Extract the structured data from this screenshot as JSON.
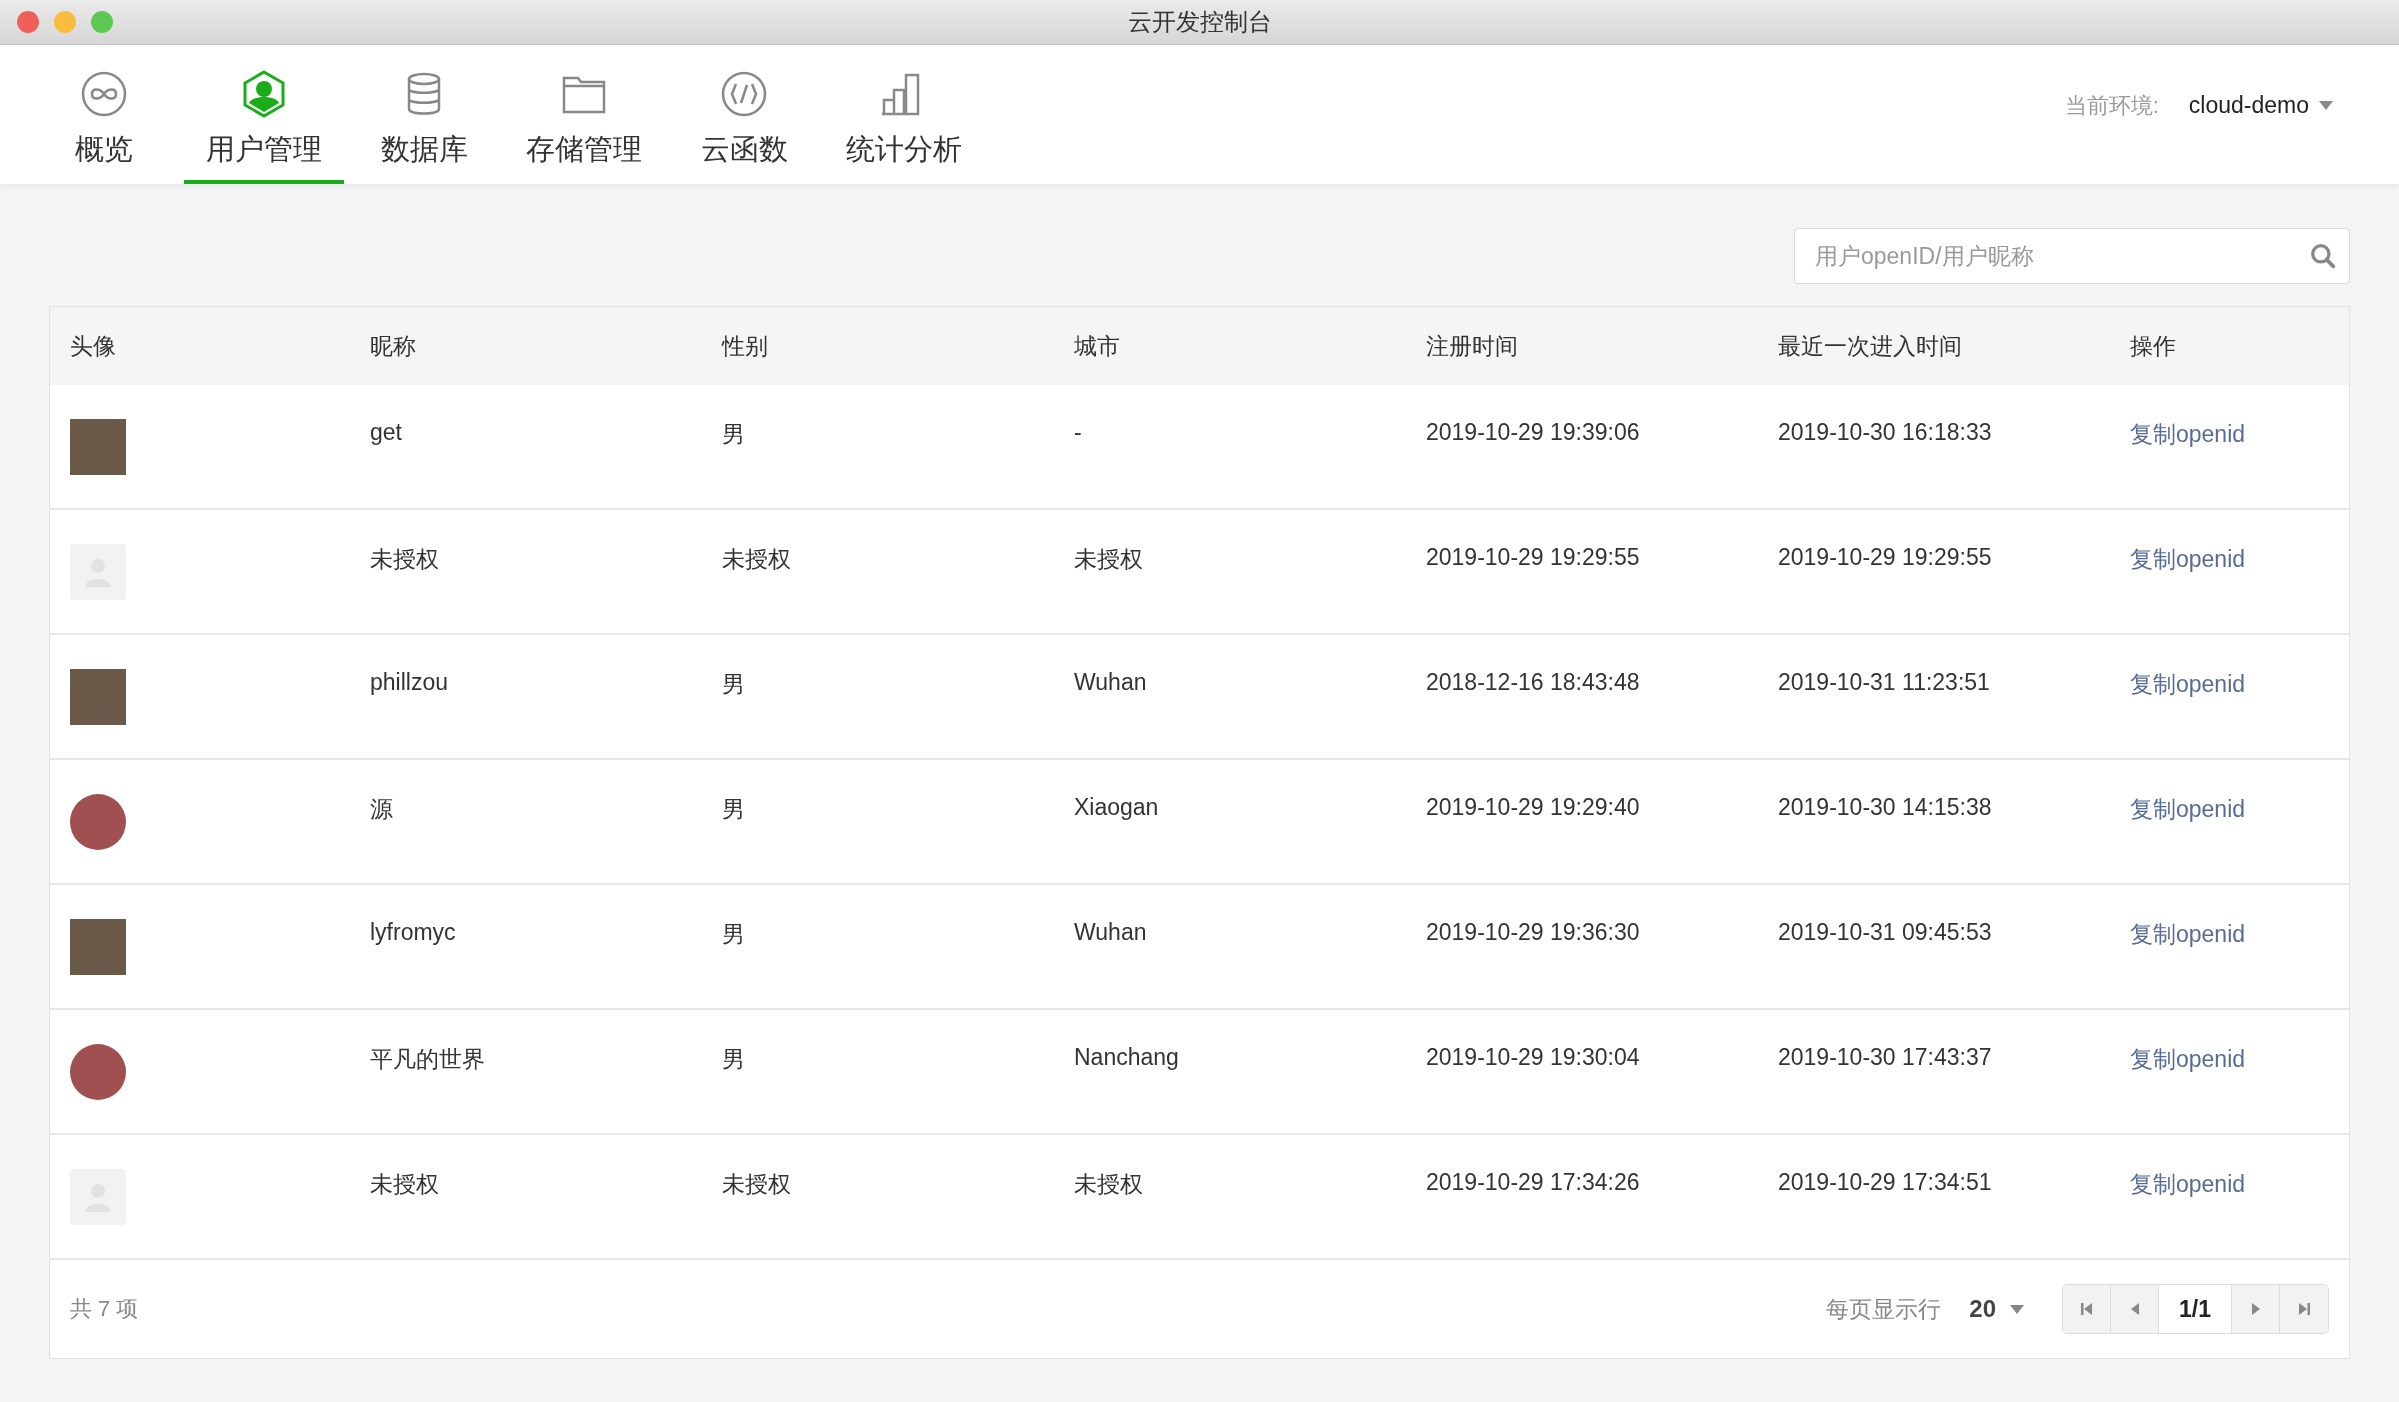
{
  "window": {
    "title": "云开发控制台"
  },
  "tabs": [
    {
      "label": "概览",
      "kind": "overview",
      "selected": false
    },
    {
      "label": "用户管理",
      "kind": "users",
      "selected": true
    },
    {
      "label": "数据库",
      "kind": "database",
      "selected": false
    },
    {
      "label": "存储管理",
      "kind": "storage",
      "selected": false
    },
    {
      "label": "云函数",
      "kind": "functions",
      "selected": false
    },
    {
      "label": "统计分析",
      "kind": "stats",
      "selected": false
    }
  ],
  "environment": {
    "label": "当前环境:",
    "value": "cloud-demo"
  },
  "search": {
    "placeholder": "用户openID/用户昵称"
  },
  "table": {
    "columns": [
      "头像",
      "昵称",
      "性别",
      "城市",
      "注册时间",
      "最近一次进入时间",
      "操作"
    ],
    "rows": [
      {
        "kind": "photo",
        "nickname": "get",
        "gender": "男",
        "city": "-",
        "registered": "2019-10-29 19:39:06",
        "last_visit": "2019-10-30 16:18:33",
        "action": "复制openid"
      },
      {
        "kind": "placeholder",
        "nickname": "未授权",
        "gender": "未授权",
        "city": "未授权",
        "registered": "2019-10-29 19:29:55",
        "last_visit": "2019-10-29 19:29:55",
        "action": "复制openid"
      },
      {
        "kind": "photo",
        "nickname": "phillzou",
        "gender": "男",
        "city": "Wuhan",
        "registered": "2018-12-16 18:43:48",
        "last_visit": "2019-10-31 11:23:51",
        "action": "复制openid"
      },
      {
        "kind": "roundphoto",
        "nickname": "源",
        "gender": "男",
        "city": "Xiaogan",
        "registered": "2019-10-29 19:29:40",
        "last_visit": "2019-10-30 14:15:38",
        "action": "复制openid"
      },
      {
        "kind": "photo",
        "nickname": "lyfromyc",
        "gender": "男",
        "city": "Wuhan",
        "registered": "2019-10-29 19:36:30",
        "last_visit": "2019-10-31 09:45:53",
        "action": "复制openid"
      },
      {
        "kind": "roundphoto",
        "nickname": "平凡的世界",
        "gender": "男",
        "city": "Nanchang",
        "registered": "2019-10-29 19:30:04",
        "last_visit": "2019-10-30 17:43:37",
        "action": "复制openid"
      },
      {
        "kind": "placeholder",
        "nickname": "未授权",
        "gender": "未授权",
        "city": "未授权",
        "registered": "2019-10-29 17:34:26",
        "last_visit": "2019-10-29 17:34:51",
        "action": "复制openid"
      }
    ]
  },
  "footer": {
    "total": "共 7 项",
    "page_size_label": "每页显示行",
    "page_size": "20",
    "page": "1/1"
  }
}
